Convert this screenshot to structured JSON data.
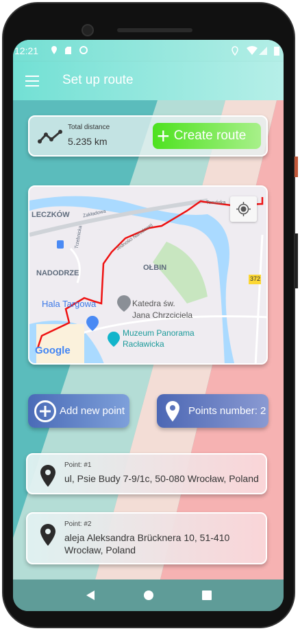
{
  "status_bar": {
    "time": "12:21"
  },
  "app_bar": {
    "title": "Set up route"
  },
  "distance": {
    "label": "Total distance",
    "value": "5.235 km"
  },
  "create_route": {
    "label": "Create route"
  },
  "map": {
    "labels": {
      "leczkow": "LECZKÓW",
      "zakladowa": "Zakładowa",
      "trzebnicka": "Trzebnicka",
      "nadodrze": "NADODRZE",
      "olbin": "OŁBIN",
      "hala": "Hala Targowa",
      "katedra1": "Katedra św.",
      "katedra2": "Jana Chrzciciela",
      "muzeum1": "Muzeum Panorama",
      "muzeum2": "Racławicka",
      "road": "372",
      "torunska": "Toruńska",
      "jednosci": "Jedności Narodowej",
      "google": "Google"
    },
    "route_color": "#ee1111"
  },
  "add_point": {
    "label": "Add new point"
  },
  "points_number": {
    "label": "Points number: 2"
  },
  "points": [
    {
      "label": "Point: #1",
      "address": "ul, Psie Budy 7-9/1c, 50-080 Wrocław, Poland"
    },
    {
      "label": "Point: #2",
      "address": "aleja Aleksandra Brücknera 10, 51-410 Wrocław, Poland"
    }
  ]
}
